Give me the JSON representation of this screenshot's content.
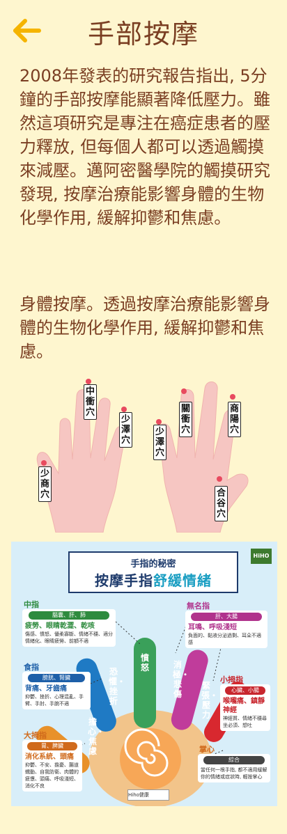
{
  "header": {
    "title": "手部按摩",
    "back_icon": "arrow-left-icon",
    "accent": "#f5b400"
  },
  "paragraphs": [
    "2008年發表的研究報告指出, 5分鐘的手部按摩能顯著降低壓力。雖然這項研究是專注在癌症患者的壓力釋放, 但每個人都可以透過觸摸來減壓。邁阿密醫學院的觸摸研究發現, 按摩治療能影響身體的生物化學作用, 緩解抑鬱和焦慮。",
    "身體按摩。透過按摩治療能影響身體的生物化學作用, 緩解抑鬱和焦慮。"
  ],
  "acupoints": {
    "zhongchong": "中衝穴",
    "shaoze_left": "少澤穴",
    "shaoshang": "少商穴",
    "guanchong": "關衝穴",
    "shaoze_right": "少澤穴",
    "shangyang": "商陽穴",
    "hegu": "合谷穴"
  },
  "infographic": {
    "subtitle": "手指的秘密",
    "title_main": "按摩手指",
    "title_highlight": "舒緩情緒",
    "brand": "HiHO",
    "fb_text": "Hiho健康",
    "categories": [
      {
        "key": "middle",
        "label": "中指",
        "organ": "腦囊、肝、肺",
        "symptom": "疲勞、眼睛乾澀、乾咳",
        "desc": "傷感、憤怒、優柔寡斷、情緒不穩、適分情緒化、眼睛疲勞、前額不適",
        "color": "#2e8b3e"
      },
      {
        "key": "ring",
        "label": "無名指",
        "organ": "肝、大腸",
        "symptom": "耳鳴、呼吸淺短",
        "desc": "負面的、黏液分泌過剩、耳朵不適感",
        "color": "#b0338c"
      },
      {
        "key": "index",
        "label": "食指",
        "organ": "膀胱、腎臟",
        "symptom": "背痛、牙齒痛",
        "desc": "抑鬱、挫折、心理混亂、手臂、手肘、手腕不適",
        "color": "#1d5fa8"
      },
      {
        "key": "little",
        "label": "小拇指",
        "organ": "心臟、小腸",
        "symptom": "喉嚨痛、鎮靜神經",
        "desc": "神經質、情緒不穩尋坐必須、想吐",
        "color": "#c8262e"
      },
      {
        "key": "thumb",
        "label": "大拇指",
        "organ": "胃、脾臟",
        "symptom": "消化系統、頭痛",
        "desc": "抑鬱、不安、擔憂、腸道蠕動、自我防衛、肉體的疲憊、頭痛、呼吸淺短、消化不良",
        "color": "#d06a1c"
      },
      {
        "key": "palm",
        "label": "掌心",
        "organ": "綜合",
        "symptom": "",
        "desc": "當任何一根手指, 都不適用緩解你的情緒或症狀時, 輕按掌心",
        "color": "#444444"
      }
    ],
    "finger_emotions": {
      "thumb": "擔心・焦慮",
      "index": "恐懼・挫折",
      "middle": "憤怒",
      "ring": "消極・悲傷",
      "little": "緊張・壓力"
    }
  }
}
